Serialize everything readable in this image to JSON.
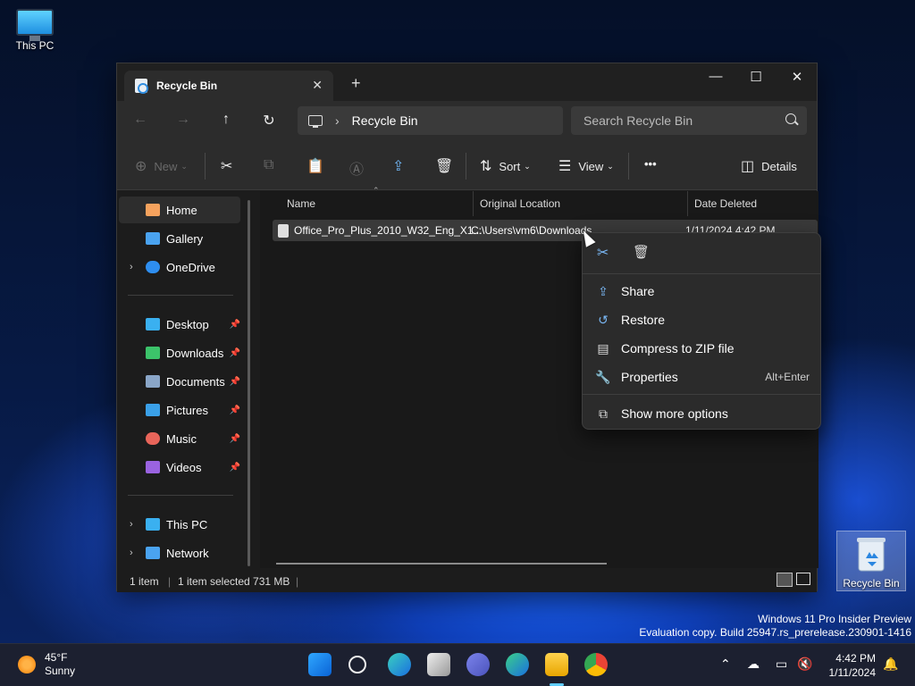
{
  "desktop": {
    "this_pc_label": "This PC",
    "recycle_bin_label": "Recycle Bin",
    "watermark_line1": "Windows 11 Pro Insider Preview",
    "watermark_line2": "Evaluation copy. Build 25947.rs_prerelease.230901-1416"
  },
  "window": {
    "tab_title": "Recycle Bin",
    "new_tab": "+",
    "address_path": "Recycle Bin",
    "search_placeholder": "Search Recycle Bin",
    "controls": {
      "minimize": "—",
      "maximize": "☐",
      "close": "✕"
    }
  },
  "commandbar": {
    "new_label": "New",
    "sort_label": "Sort",
    "view_label": "View",
    "more_label": "•••",
    "details_label": "Details"
  },
  "sidebar": {
    "items": [
      {
        "label": "Home",
        "icon": "home-icon",
        "color": "#f5a25d"
      },
      {
        "label": "Gallery",
        "icon": "gallery-icon",
        "color": "#4aa3f0"
      },
      {
        "label": "OneDrive",
        "icon": "onedrive-icon",
        "color": "#2e8ef0"
      },
      {
        "label": "Desktop",
        "icon": "desktop-icon",
        "color": "#3ab0f0"
      },
      {
        "label": "Downloads",
        "icon": "downloads-icon",
        "color": "#3cc36a"
      },
      {
        "label": "Documents",
        "icon": "documents-icon",
        "color": "#8aa6c8"
      },
      {
        "label": "Pictures",
        "icon": "pictures-icon",
        "color": "#3aa0e8"
      },
      {
        "label": "Music",
        "icon": "music-icon",
        "color": "#e8655a"
      },
      {
        "label": "Videos",
        "icon": "videos-icon",
        "color": "#9a63e0"
      },
      {
        "label": "This PC",
        "icon": "this-pc-icon",
        "color": "#3ab0f0"
      },
      {
        "label": "Network",
        "icon": "network-icon",
        "color": "#4aa3f0"
      }
    ]
  },
  "columns": {
    "name": "Name",
    "original_location": "Original Location",
    "date_deleted": "Date Deleted"
  },
  "files": [
    {
      "name": "Office_Pro_Plus_2010_W32_Eng_X1...",
      "location": "C:\\Users\\vm6\\Downloads",
      "date_deleted": "1/11/2024 4:42 PM"
    }
  ],
  "status": {
    "count": "1 item",
    "selected": "1 item selected  731 MB"
  },
  "context_menu": {
    "items": [
      {
        "label": "Share",
        "icon": "share-icon",
        "accel": ""
      },
      {
        "label": "Restore",
        "icon": "restore-icon",
        "accel": ""
      },
      {
        "label": "Compress to ZIP file",
        "icon": "zip-icon",
        "accel": ""
      },
      {
        "label": "Properties",
        "icon": "wrench-icon",
        "accel": "Alt+Enter"
      },
      {
        "label": "Show more options",
        "icon": "more-options-icon",
        "accel": ""
      }
    ]
  },
  "taskbar": {
    "weather_temp": "45°F",
    "weather_desc": "Sunny",
    "time": "4:42 PM",
    "date": "1/11/2024"
  }
}
